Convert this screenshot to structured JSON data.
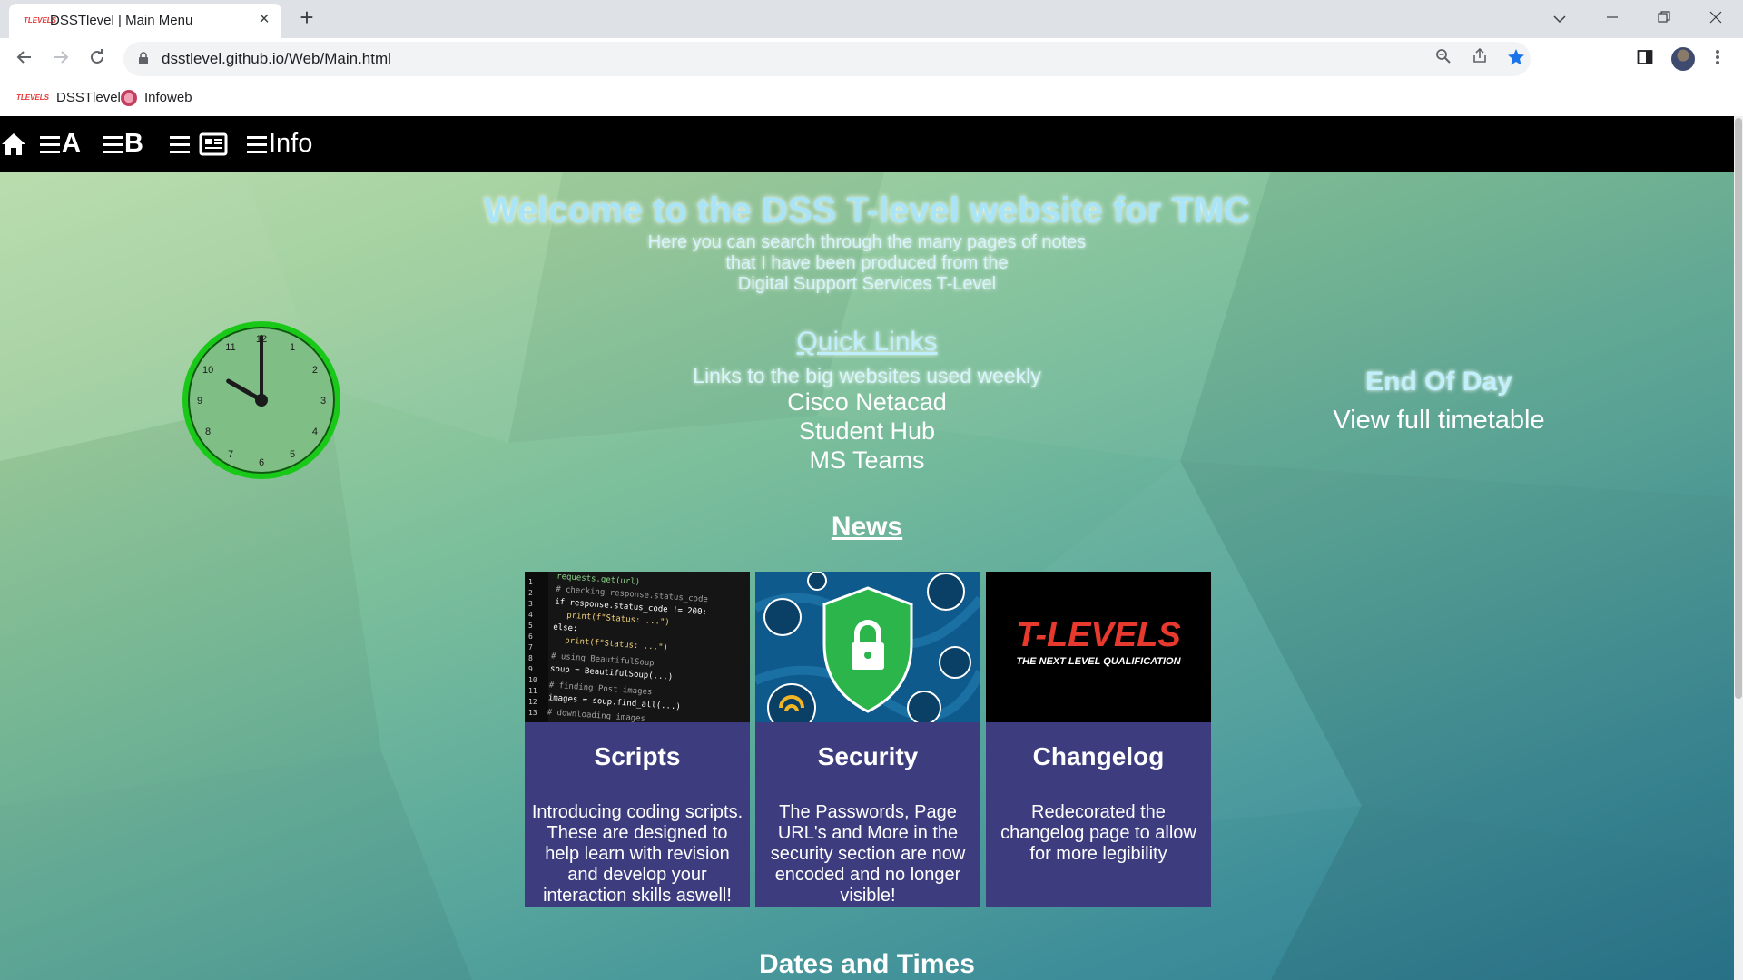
{
  "browser": {
    "tab_title": "DSSTlevel | Main Menu",
    "tab_favicon_text": "TLEVELS",
    "url": "dsstlevel.github.io/Web/Main.html",
    "bookmarks": [
      {
        "label": "DSSTlevel",
        "icon": "tlevels-favicon"
      },
      {
        "label": "Infoweb",
        "icon": "infoweb-favicon"
      }
    ]
  },
  "site_nav": {
    "items": [
      {
        "icon": "home-icon",
        "label": ""
      },
      {
        "icon": "menu-icon",
        "label": "A"
      },
      {
        "icon": "menu-icon",
        "label": "B"
      },
      {
        "icon": "newspaper-icon",
        "label": ""
      },
      {
        "icon": "menu-icon",
        "label": "Info"
      }
    ]
  },
  "hero": {
    "title": "Welcome to the DSS T-level website for TMC",
    "lines": [
      "Here you can search through the many pages of notes",
      "that I have been produced from the",
      "Digital Support Services T-Level"
    ]
  },
  "clock": {
    "hours": 10,
    "minutes": 0,
    "numbers": [
      "12",
      "1",
      "2",
      "3",
      "4",
      "5",
      "6",
      "7",
      "8",
      "9",
      "10",
      "11"
    ]
  },
  "quick_links": {
    "title": "Quick Links",
    "subtitle": "Links to the big websites used weekly",
    "links": [
      "Cisco Netacad",
      "Student Hub",
      "MS Teams"
    ]
  },
  "end_of_day": {
    "title": "End Of Day",
    "link": "View full timetable"
  },
  "news": {
    "title": "News",
    "cards": [
      {
        "title": "Scripts",
        "text": "Introducing coding scripts. These are designed to help learn with revision and develop your interaction skills aswell!",
        "image": "code-screenshot"
      },
      {
        "title": "Security",
        "text": "The Passwords, Page URL's and More in the security section are now encoded and no longer visible!",
        "image": "security-shield"
      },
      {
        "title": "Changelog",
        "text": "Redecorated the changelog page to allow for more legibility",
        "image": "tlevels-logo",
        "logo_text": "T-LEVELS",
        "logo_sub": "THE NEXT LEVEL QUALIFICATION"
      }
    ]
  },
  "dates": {
    "title": "Dates and Times"
  },
  "colors": {
    "card_bg": "#3d3c7e",
    "nav_bg": "#000000",
    "clock_ring": "#18c918",
    "accent_text": "#a9e4f7",
    "bookmark_star": "#1a73e8"
  }
}
